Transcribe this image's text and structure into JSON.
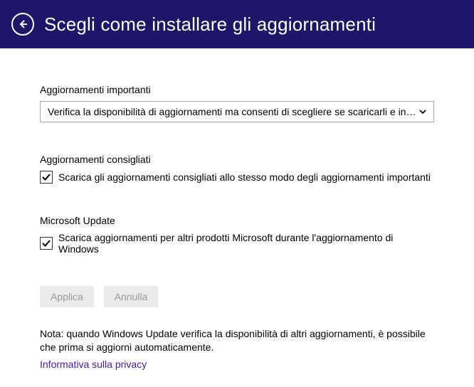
{
  "header": {
    "title": "Scegli come installare gli aggiornamenti"
  },
  "important": {
    "label": "Aggiornamenti importanti",
    "dropdown_value": "Verifica la disponibilità di aggiornamenti ma consenti di scegliere se scaricarli e inst..."
  },
  "recommended": {
    "label": "Aggiornamenti consigliati",
    "checkbox_label": "Scarica gli aggiornamenti consigliati allo stesso modo degli aggiornamenti importanti",
    "checked": true
  },
  "ms_update": {
    "label": "Microsoft Update",
    "checkbox_label": "Scarica aggiornamenti per altri prodotti Microsoft durante l'aggiornamento di Windows",
    "checked": true
  },
  "buttons": {
    "apply": "Applica",
    "cancel": "Annulla"
  },
  "note": "Nota: quando Windows Update verifica la disponibilità di altri aggiornamenti, è possibile che prima si aggiorni automaticamente.",
  "privacy": "Informativa sulla privacy"
}
